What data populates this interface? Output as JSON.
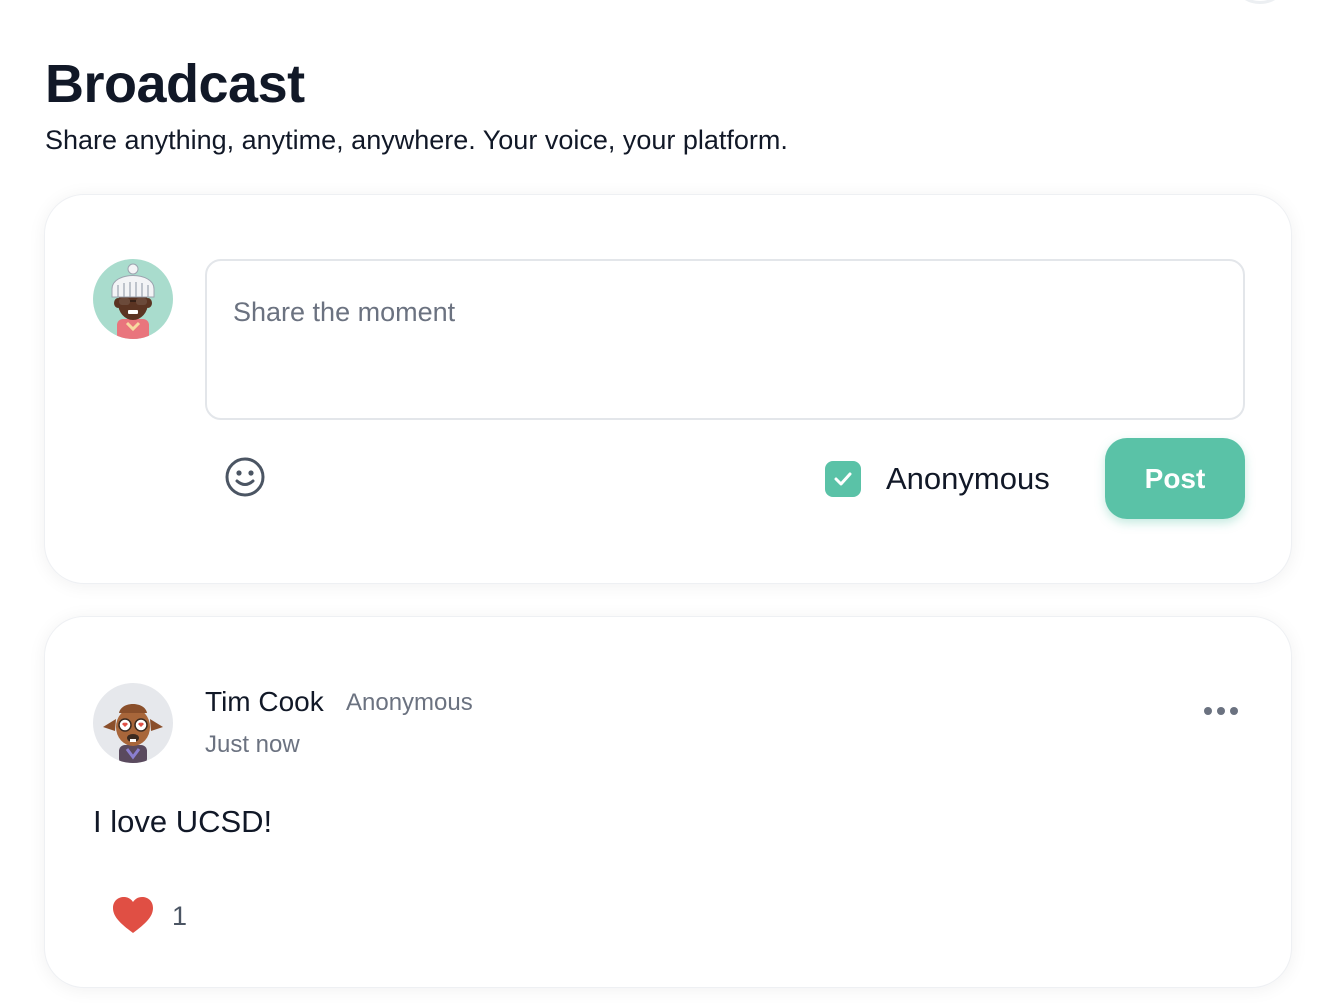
{
  "header": {
    "title": "Broadcast",
    "subtitle": "Share anything, anytime, anywhere. Your voice, your platform."
  },
  "composer": {
    "placeholder": "Share the moment",
    "value": "",
    "anonymous_label": "Anonymous",
    "anonymous_checked": true,
    "post_label": "Post",
    "icons": [
      "avatar",
      "smiley-icon",
      "check-icon"
    ]
  },
  "posts": [
    {
      "author": "Tim Cook",
      "tag": "Anonymous",
      "time": "Just now",
      "body": "I love UCSD!",
      "likes": "1",
      "liked": true,
      "icons": [
        "avatar",
        "more-dots-icon",
        "heart-icon"
      ]
    }
  ],
  "colors": {
    "accent": "#5ac2a7",
    "heart": "#e04f44",
    "text": "#111827",
    "muted": "#6b7280"
  }
}
